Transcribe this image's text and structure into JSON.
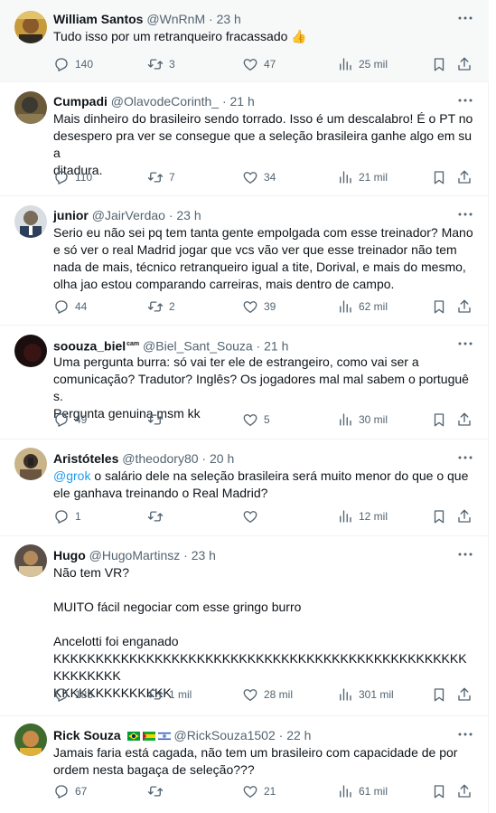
{
  "tweets": [
    {
      "name": "William Santos",
      "handle": "@WnRnM",
      "time": "23 h",
      "text": "Tudo isso por um retranqueiro fracassado 👍",
      "replies": "140",
      "retweets": "3",
      "likes": "47",
      "views": "25 mil"
    },
    {
      "name": "Cumpadi",
      "handle": "@OlavodeCorinth_",
      "time": "21 h",
      "text": "Mais dinheiro do brasileiro sendo torrado. Isso é um descalabro! É o PT no\ndesespero pra ver se consegue que a seleção brasileira ganhe algo em sua\nditadura.",
      "replies": "110",
      "retweets": "7",
      "likes": "34",
      "views": "21 mil"
    },
    {
      "name": "junior",
      "handle": "@JairVerdao",
      "time": "23 h",
      "text": "Serio eu não sei pq tem tanta gente empolgada com esse treinador? Mano\ne só ver o real Madrid jogar que vcs vão ver que esse treinador não tem\nnada de mais, técnico retranqueiro igual a tite, Dorival, e mais do mesmo,\nolha jao estou comparando carreiras, mais dentro de campo.",
      "replies": "44",
      "retweets": "2",
      "likes": "39",
      "views": "62 mil"
    },
    {
      "name": "soouza_biel",
      "badge": "cam",
      "handle": "@Biel_Sant_Souza",
      "time": "21 h",
      "text": "Uma pergunta burra: só vai ter ele de estrangeiro, como vai ser a\ncomunicação? Tradutor? Inglês? Os jogadores mal mal sabem o português.\nPergunta genuina msm kk",
      "replies": "49",
      "retweets": "",
      "likes": "5",
      "views": "30 mil"
    },
    {
      "name": "Aristóteles",
      "handle": "@theodory80",
      "time": "20 h",
      "mention": "@grok",
      "text": " o salário dele na seleção brasileira será muito menor do que o que\nele ganhava treinando o Real Madrid?",
      "replies": "1",
      "retweets": "",
      "likes": "",
      "views": "12 mil"
    },
    {
      "name": "Hugo",
      "handle": "@HugoMartinsz",
      "time": "23 h",
      "text": "Não tem VR?\n\nMUITO fácil negociar com esse gringo burro\n\nAncelotti foi enganado\nKKKKKKKKKKKKKKKKKKKKKKKKKKKKKKKKKKKKKKKKKKKKKKKKKKKKKKKKK\nKKKKKKKKKKKKKK",
      "replies": "183",
      "retweets": "1 mil",
      "likes": "28 mil",
      "views": "301 mil"
    },
    {
      "name": "Rick Souza",
      "handle": "@RickSouza1502",
      "time": "22 h",
      "text": "Jamais faria está cagada, não tem um brasileiro com capacidade de por\nordem nesta bagaça de seleção???",
      "replies": "67",
      "retweets": "",
      "likes": "21",
      "views": "61 mil"
    }
  ],
  "colors": {
    "text": "#0f1419",
    "secondary": "#536471",
    "accent": "#1d9bf0",
    "highlight": "#f7f9f9"
  },
  "icons": [
    "more-icon",
    "reply-icon",
    "retweet-icon",
    "like-icon",
    "views-icon",
    "bookmark-icon",
    "share-icon",
    "flag-brazil-icon",
    "flag-sao-tome-icon",
    "flag-israel-icon"
  ]
}
